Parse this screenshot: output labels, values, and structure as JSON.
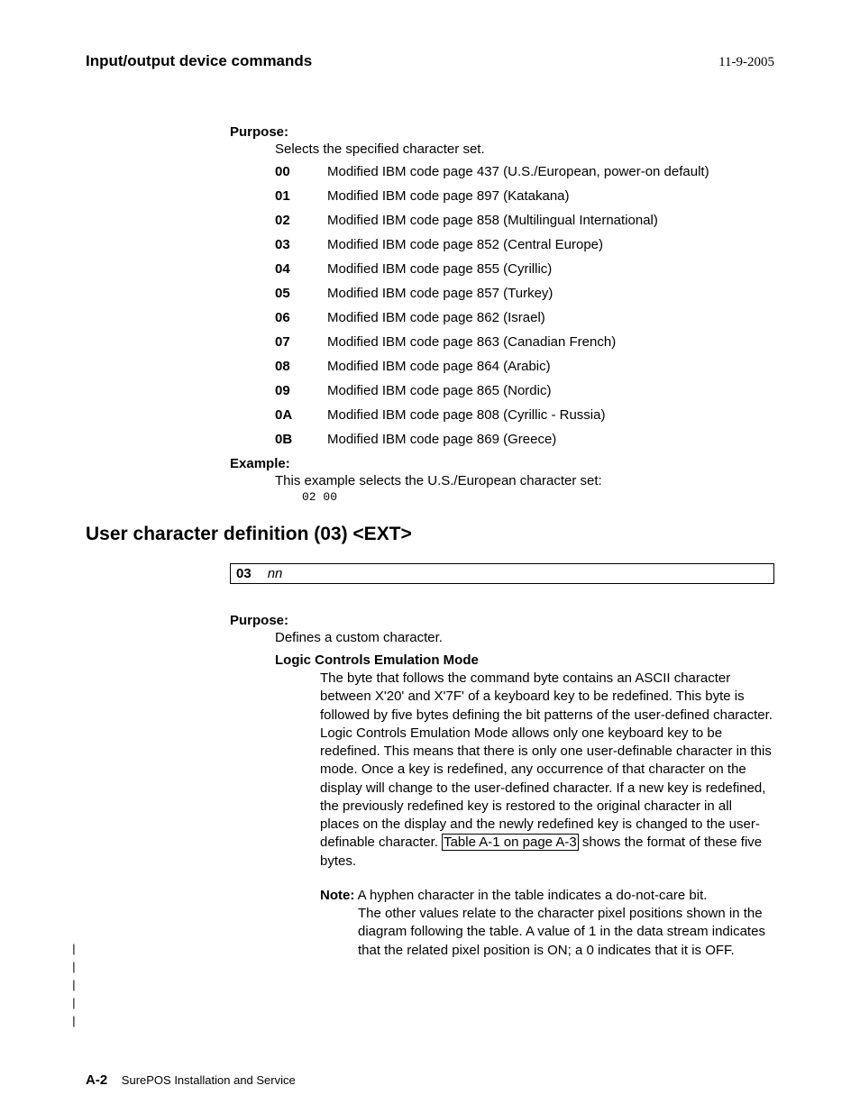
{
  "header": {
    "title": "Input/output device commands",
    "date": "11-9-2005"
  },
  "purpose1": {
    "label": "Purpose:",
    "intro": "Selects the specified character set.",
    "codes": [
      {
        "k": "00",
        "d": "Modified IBM code page 437 (U.S./European, power-on default)"
      },
      {
        "k": "01",
        "d": "Modified IBM code page 897 (Katakana)"
      },
      {
        "k": "02",
        "d": "Modified IBM code page 858 (Multilingual International)"
      },
      {
        "k": "03",
        "d": "Modified IBM code page 852 (Central Europe)"
      },
      {
        "k": "04",
        "d": "Modified IBM code page 855 (Cyrillic)"
      },
      {
        "k": "05",
        "d": "Modified IBM code page 857 (Turkey)"
      },
      {
        "k": "06",
        "d": "Modified IBM code page 862 (Israel)"
      },
      {
        "k": "07",
        "d": "Modified IBM code page 863 (Canadian French)"
      },
      {
        "k": "08",
        "d": "Modified IBM code page 864 (Arabic)"
      },
      {
        "k": "09",
        "d": "Modified IBM code page 865 (Nordic)"
      },
      {
        "k": "0A",
        "d": "Modified IBM code page 808 (Cyrillic - Russia)"
      },
      {
        "k": "0B",
        "d": "Modified IBM code page 869 (Greece)"
      }
    ]
  },
  "example1": {
    "label": "Example:",
    "text": "This example selects the U.S./European character set:",
    "code": "02 00"
  },
  "section2": {
    "heading": "User character definition (03) <EXT>",
    "syntax_code": "03",
    "syntax_param": "nn"
  },
  "purpose2": {
    "label": "Purpose:",
    "intro": "Defines a custom character.",
    "sub_heading": "Logic Controls Emulation Mode",
    "body_pre": "The byte that follows the command byte contains an ASCII character between X'20' and X'7F' of a keyboard key to be redefined. This byte is followed by five bytes defining the bit patterns of the user-defined character. Logic Controls Emulation Mode allows only one keyboard key to be redefined. This means that there is only one user-definable character in this mode. Once a key is redefined, any occurrence of that character on the display will change to the user-defined character. If a new key is redefined, the previously redefined key is restored to the original character in all places on the display and the newly redefined key is changed to the user-definable character. ",
    "link_text": "Table A-1 on page A-3",
    "body_post": " shows the format of these five bytes.",
    "note_label": "Note:",
    "note_first": " A hyphen character in the table indicates a do-not-care bit.",
    "note_rest": "The other values relate to the character pixel positions shown in the diagram following the table. A value of 1 in the data stream indicates that the related pixel position is ON; a 0 indicates that it is OFF."
  },
  "footer": {
    "page": "A-2",
    "doc": "SurePOS Installation and Service"
  }
}
